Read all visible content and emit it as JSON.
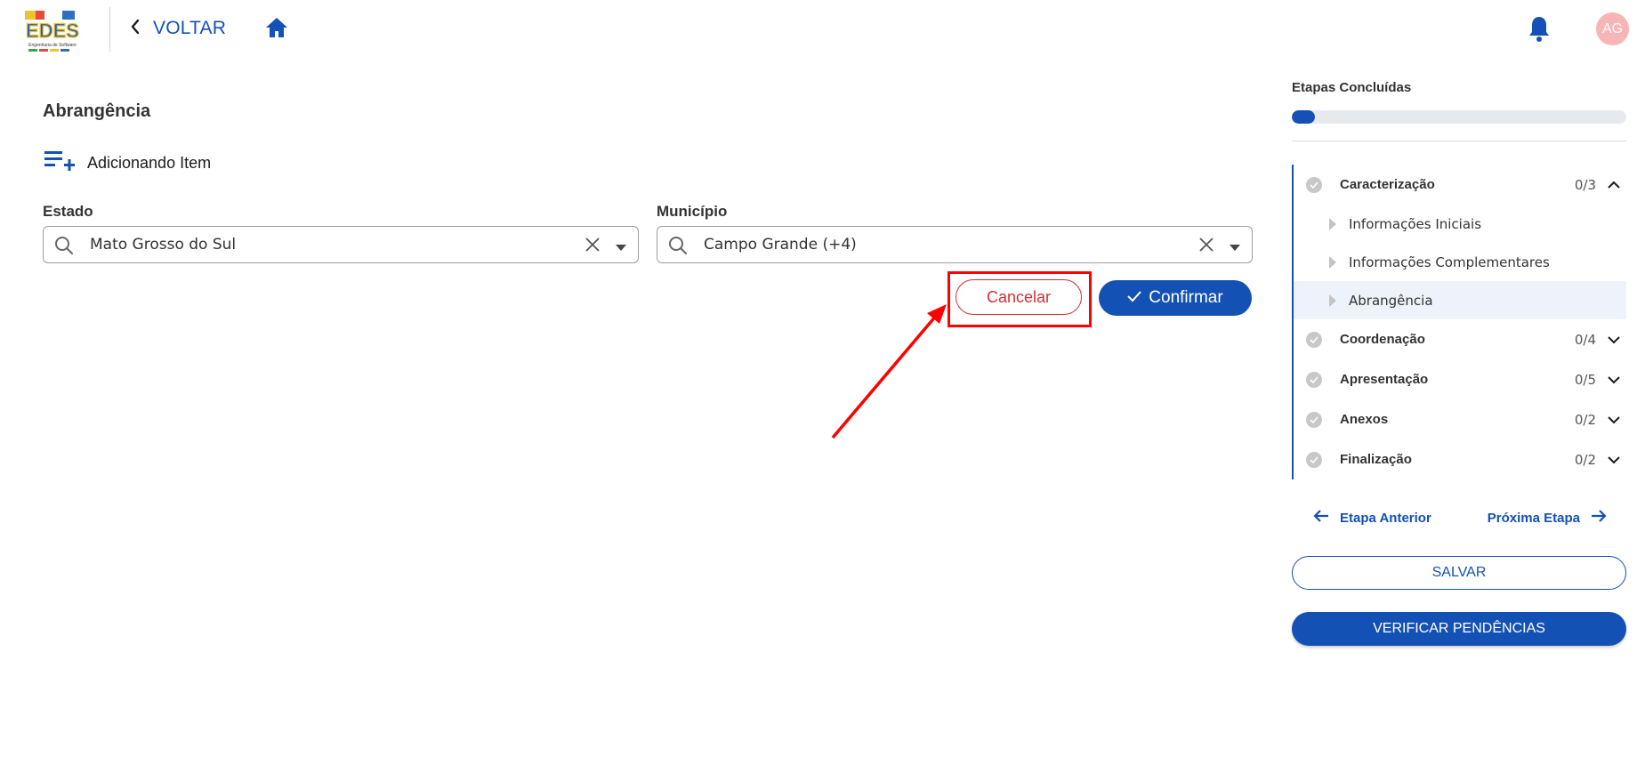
{
  "header": {
    "logo_text": "EDES",
    "logo_subtitle": "Engenharia de Software",
    "back_label": "VOLTAR",
    "avatar_initials": "AG"
  },
  "main": {
    "section_title": "Abrangência",
    "adding_label": "Adicionando Item",
    "estado": {
      "label": "Estado",
      "value": "Mato Grosso do Sul"
    },
    "municipio": {
      "label": "Município",
      "value": "Campo Grande (+4)"
    },
    "cancel_label": "Cancelar",
    "confirm_label": "Confirmar"
  },
  "panel": {
    "title": "Etapas Concluídas",
    "progress_fraction": 0.07,
    "steps": [
      {
        "name": "Caracterização",
        "count": "0/3",
        "expanded": true,
        "substeps": [
          "Informações Iniciais",
          "Informações Complementares",
          "Abrangência"
        ]
      },
      {
        "name": "Coordenação",
        "count": "0/4",
        "expanded": false
      },
      {
        "name": "Apresentação",
        "count": "0/5",
        "expanded": false
      },
      {
        "name": "Anexos",
        "count": "0/2",
        "expanded": false
      },
      {
        "name": "Finalização",
        "count": "0/2",
        "expanded": false
      }
    ],
    "prev_label": "Etapa Anterior",
    "next_label": "Próxima Etapa",
    "save_label": "SALVAR",
    "verify_label": "VERIFICAR PENDÊNCIAS"
  },
  "colors": {
    "primary": "#1351b4",
    "danger": "#d32f2f",
    "highlight": "#ff0000",
    "avatar_bg": "#f8b5b5"
  }
}
